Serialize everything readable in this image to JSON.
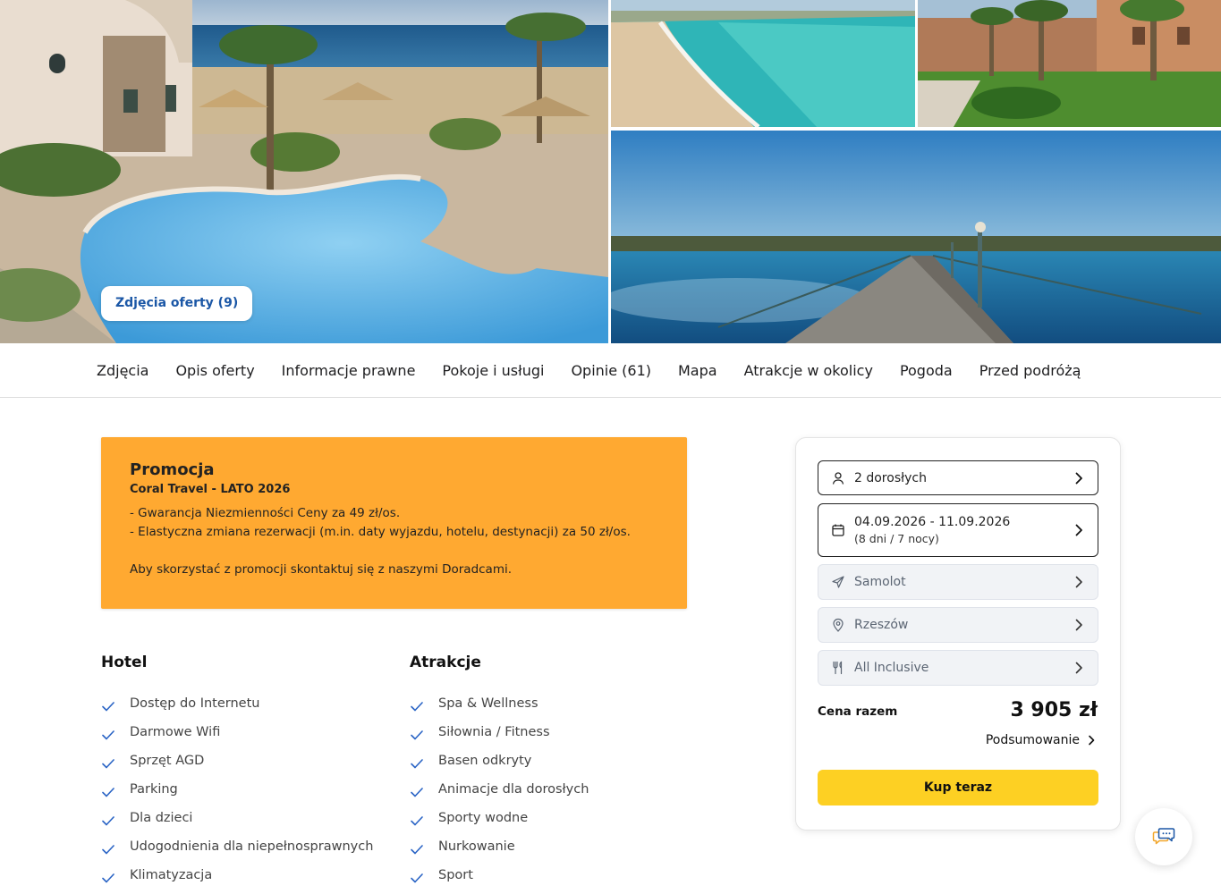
{
  "gallery": {
    "photos_button": "Zdjęcia oferty (9)",
    "photos": [
      "hotel-pool-photo",
      "beach-photo",
      "garden-photo",
      "pier-photo"
    ]
  },
  "tabs": [
    {
      "label": "Zdjęcia"
    },
    {
      "label": "Opis oferty"
    },
    {
      "label": "Informacje prawne"
    },
    {
      "label": "Pokoje i usługi"
    },
    {
      "label": "Opinie (61)"
    },
    {
      "label": "Mapa"
    },
    {
      "label": "Atrakcje w okolicy"
    },
    {
      "label": "Pogoda"
    },
    {
      "label": "Przed podróżą"
    }
  ],
  "promo": {
    "title": "Promocja",
    "subtitle": "Coral Travel - LATO 2026",
    "lines": [
      "- Gwarancja Niezmienności Ceny za 49 zł/os.",
      "- Elastyczna zmiana rezerwacji (m.in. daty wyjazdu, hotelu, destynacji) za 50 zł/os."
    ],
    "note": "Aby skorzystać z promocji skontaktuj się z naszymi Doradcami.",
    "background": "#ffa931"
  },
  "hotel": {
    "heading": "Hotel",
    "items": [
      "Dostęp do Internetu",
      "Darmowe Wifi",
      "Sprzęt AGD",
      "Parking",
      "Dla dzieci",
      "Udogodnienia dla niepełnosprawnych",
      "Klimatyzacja"
    ]
  },
  "attractions": {
    "heading": "Atrakcje",
    "items": [
      "Spa & Wellness",
      "Siłownia / Fitness",
      "Basen odkryty",
      "Animacje dla dorosłych",
      "Sporty wodne",
      "Nurkowanie",
      "Sport"
    ]
  },
  "booking": {
    "travelers": "2 dorosłych",
    "dates": "04.09.2026 - 11.09.2026",
    "duration": "(8 dni / 7 nocy)",
    "transport": "Samolot",
    "departure": "Rzeszów",
    "board": "All Inclusive",
    "price_label": "Cena razem",
    "price": "3 905 zł",
    "summary": "Podsumowanie",
    "buy": "Kup teraz",
    "buy_color": "#fdd023",
    "icons": [
      "person-icon",
      "calendar-icon",
      "plane-icon",
      "location-pin-icon",
      "cutlery-icon",
      "chevron-right-icon"
    ]
  },
  "colors": {
    "accent_blue": "#1b57a6",
    "check_blue": "#2a64c5"
  }
}
